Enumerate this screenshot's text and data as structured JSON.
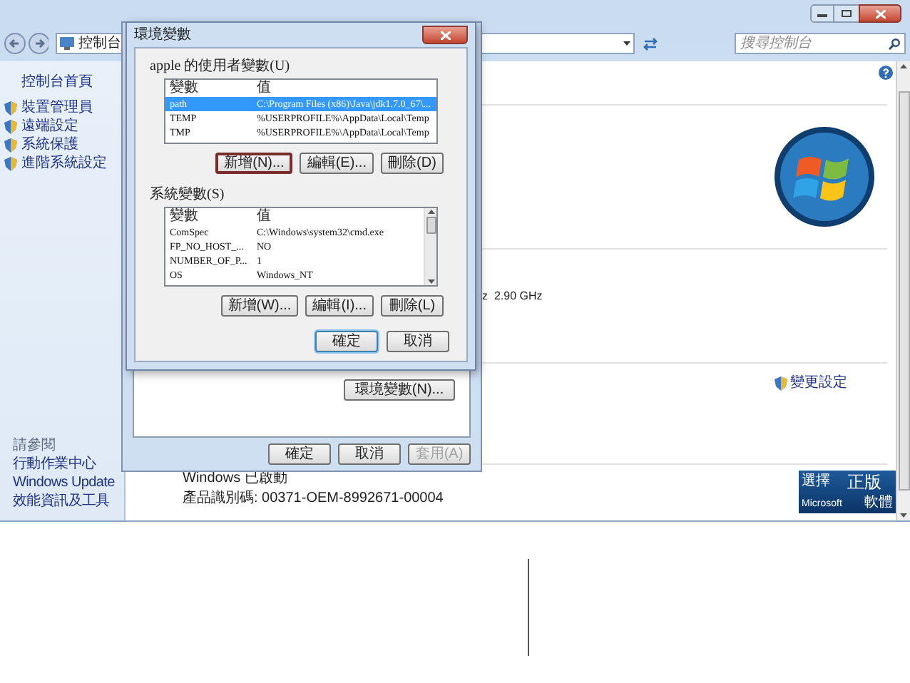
{
  "explorer": {
    "breadcrumb": [
      "控制台"
    ],
    "search": {
      "placeholder": "搜尋控制台"
    },
    "sidebar": {
      "home": "控制台首頁",
      "items": [
        "裝置管理員",
        "遠端設定",
        "系統保護",
        "進階系統設定"
      ],
      "see_also": {
        "title": "請參閱",
        "items": [
          "行動作業中心",
          "Windows Update",
          "效能資訊及工具"
        ]
      }
    },
    "content": {
      "processor_speed": "z  2.90 GHz",
      "change_settings": "變更設定",
      "activation": "Windows 已啟動",
      "product_id": "產品識別碼: 00371-OEM-8992671-00004",
      "genuine_badge": {
        "top": "選擇",
        "main": "正版",
        "brand": "Microsoft",
        "bottom": "軟體"
      }
    }
  },
  "system_properties": {
    "env_button": "環境變數(N)...",
    "buttons": [
      {
        "label": "確定",
        "disabled": false
      },
      {
        "label": "取消",
        "disabled": false
      },
      {
        "label": "套用(A)",
        "disabled": true
      }
    ]
  },
  "env_dialog": {
    "title": "環境變數",
    "user_vars": {
      "label": "apple 的使用者變數(U)",
      "columns": [
        "變數",
        "值"
      ],
      "rows": [
        {
          "cells": [
            "path",
            "C:\\Program Files (x86)\\Java\\jdk1.7.0_67\\..."
          ],
          "selected": true
        },
        {
          "cells": [
            "TEMP",
            "%USERPROFILE%\\AppData\\Local\\Temp"
          ],
          "selected": false
        },
        {
          "cells": [
            "TMP",
            "%USERPROFILE%\\AppData\\Local\\Temp"
          ],
          "selected": false
        }
      ],
      "buttons": [
        {
          "label": "新增(N)...",
          "highlighted": true
        },
        {
          "label": "編輯(E)...",
          "highlighted": false
        },
        {
          "label": "刪除(D)",
          "highlighted": false
        }
      ]
    },
    "system_vars": {
      "label": "系統變數(S)",
      "columns": [
        "變數",
        "值"
      ],
      "rows": [
        {
          "cells": [
            "ComSpec",
            "C:\\Windows\\system32\\cmd.exe"
          ],
          "selected": false
        },
        {
          "cells": [
            "FP_NO_HOST_...",
            "NO"
          ],
          "selected": false
        },
        {
          "cells": [
            "NUMBER_OF_P...",
            "1"
          ],
          "selected": false
        },
        {
          "cells": [
            "OS",
            "Windows_NT"
          ],
          "selected": false
        }
      ],
      "buttons": [
        {
          "label": "新增(W)...",
          "highlighted": false
        },
        {
          "label": "編輯(I)...",
          "highlighted": false
        },
        {
          "label": "刪除(L)",
          "highlighted": false
        }
      ]
    },
    "buttons": [
      {
        "label": "確定",
        "default": true
      },
      {
        "label": "取消",
        "default": false
      }
    ]
  }
}
